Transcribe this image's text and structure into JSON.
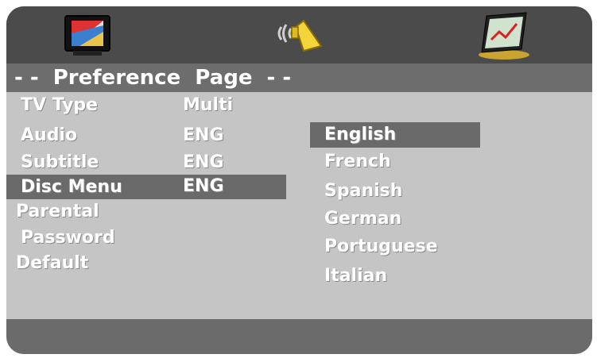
{
  "top_icons": [
    {
      "name": "tv-display-icon"
    },
    {
      "name": "audio-speaker-icon"
    },
    {
      "name": "chart-preferences-icon"
    }
  ],
  "page_title": "- -  Preference  Page  - -",
  "settings": [
    {
      "label": "TV Type",
      "value": "Multi"
    },
    {
      "label": "Audio",
      "value": "ENG"
    },
    {
      "label": "Subtitle",
      "value": "ENG"
    },
    {
      "label": "Disc Menu",
      "value": "ENG",
      "selected": true
    },
    {
      "label": "Parental",
      "value": ""
    },
    {
      "label": "Password",
      "value": ""
    },
    {
      "label": "Default",
      "value": ""
    }
  ],
  "options": [
    {
      "label": "English",
      "selected": true
    },
    {
      "label": "French"
    },
    {
      "label": "Spanish"
    },
    {
      "label": "German"
    },
    {
      "label": "Portuguese"
    },
    {
      "label": "Italian"
    }
  ],
  "colors": {
    "frame_dark": "#4b4b4b",
    "title_bar": "#6d6d6d",
    "content_bg": "#c5c5c5",
    "highlight": "#6a6a6a",
    "text": "#ffffff"
  }
}
